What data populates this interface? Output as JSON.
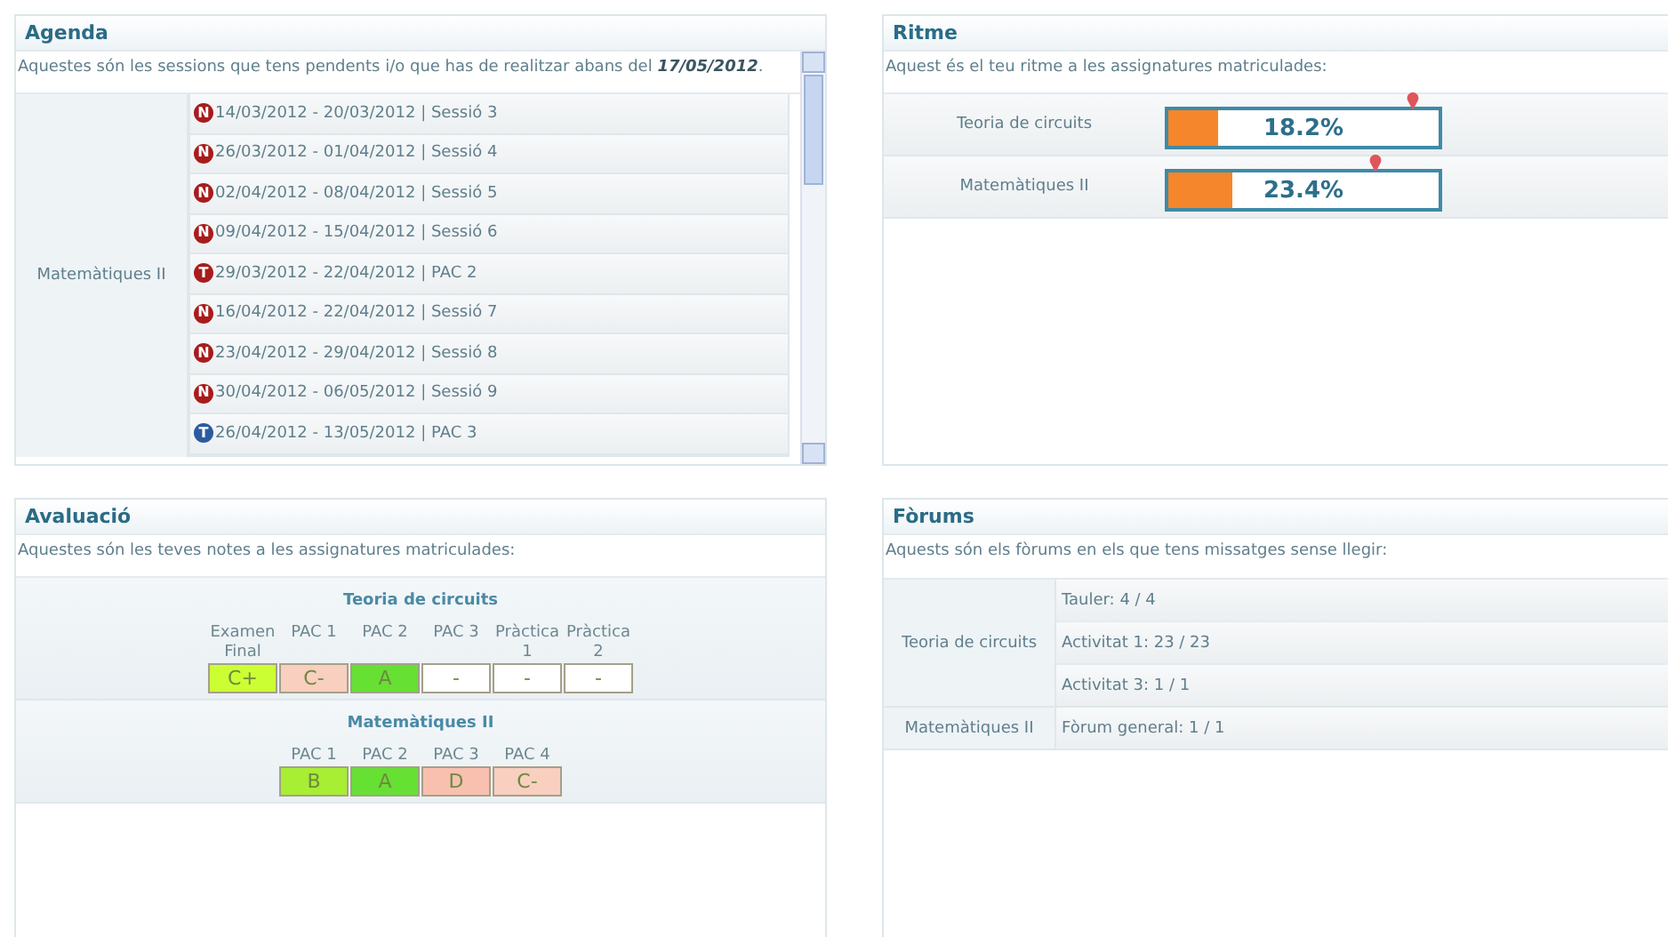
{
  "agenda": {
    "title": "Agenda",
    "description": "Aquestes són les sessions que tens pendents i/o que has de realitzar abans del **17/05/2012**.",
    "subject": "Matemàtiques II",
    "items": [
      {
        "badge": "N",
        "color": "#a81c1c",
        "text": "14/03/2012 - 20/03/2012 | Sessió 3"
      },
      {
        "badge": "N",
        "color": "#a81c1c",
        "text": "26/03/2012 - 01/04/2012 | Sessió 4"
      },
      {
        "badge": "N",
        "color": "#a81c1c",
        "text": "02/04/2012 - 08/04/2012 | Sessió 5"
      },
      {
        "badge": "N",
        "color": "#a81c1c",
        "text": "09/04/2012 - 15/04/2012 | Sessió 6"
      },
      {
        "badge": "T",
        "color": "#a81c1c",
        "text": "29/03/2012 - 22/04/2012 | PAC 2"
      },
      {
        "badge": "N",
        "color": "#a81c1c",
        "text": "16/04/2012 - 22/04/2012 | Sessió 7"
      },
      {
        "badge": "N",
        "color": "#a81c1c",
        "text": "23/04/2012 - 29/04/2012 | Sessió 8"
      },
      {
        "badge": "N",
        "color": "#a81c1c",
        "text": "30/04/2012 - 06/05/2012 | Sessió 9"
      },
      {
        "badge": "T",
        "color": "#2c5aa0",
        "text": "26/04/2012 - 13/05/2012 | PAC 3"
      }
    ]
  },
  "ritme": {
    "title": "Ritme",
    "description": "Aquest és el teu ritme a les assignatures matriculades:",
    "subjects": [
      {
        "name": "Teoria de circuits",
        "level": 0.182,
        "reading": "18.2%",
        "target": {
          "level": 0.9
        }
      },
      {
        "name": "Matemàtiques II",
        "level": 0.234,
        "reading": "23.4%",
        "target": {
          "level": 0.76
        }
      }
    ]
  },
  "avaluacio": {
    "title": "Avaluació",
    "description": "Aquestes són les teves notes a les assignatures matriculades:",
    "subjects": [
      {
        "name": "Teoria de circuits",
        "grades": [
          {
            "label": "Examen Final",
            "grade": "C+",
            "color": "#ccff33"
          },
          {
            "label": "PAC 1",
            "grade": "C-",
            "color": "#f9cfc0"
          },
          {
            "label": "PAC 2",
            "grade": "A",
            "color": "#66e033"
          },
          {
            "label": "PAC 3",
            "grade": "-",
            "color": "#ffffff"
          },
          {
            "label": "Pràctica 1",
            "grade": "-",
            "color": "#ffffff"
          },
          {
            "label": "Pràctica 2",
            "grade": "-",
            "color": "#ffffff"
          }
        ]
      },
      {
        "name": "Matemàtiques II",
        "grades": [
          {
            "label": "PAC 1",
            "grade": "B",
            "color": "#a8ee33"
          },
          {
            "label": "PAC 2",
            "grade": "A",
            "color": "#66e033"
          },
          {
            "label": "PAC 3",
            "grade": "D",
            "color": "#f9c0b0"
          },
          {
            "label": "PAC 4",
            "grade": "C-",
            "color": "#f9cfc0"
          }
        ]
      }
    ]
  },
  "forums": {
    "title": "Fòrums",
    "description": "Aquests són els fòrums en els que tens missatges sense llegir:",
    "subjects": [
      {
        "name": "Teoria de circuits",
        "forums": [
          "Tauler: 4 / 4",
          "Activitat 1: 23 / 23",
          "Activitat 3: 1 / 1"
        ]
      },
      {
        "name": "Matemàtiques II",
        "forums": [
          "Fòrum general: 1 / 1"
        ]
      }
    ]
  }
}
